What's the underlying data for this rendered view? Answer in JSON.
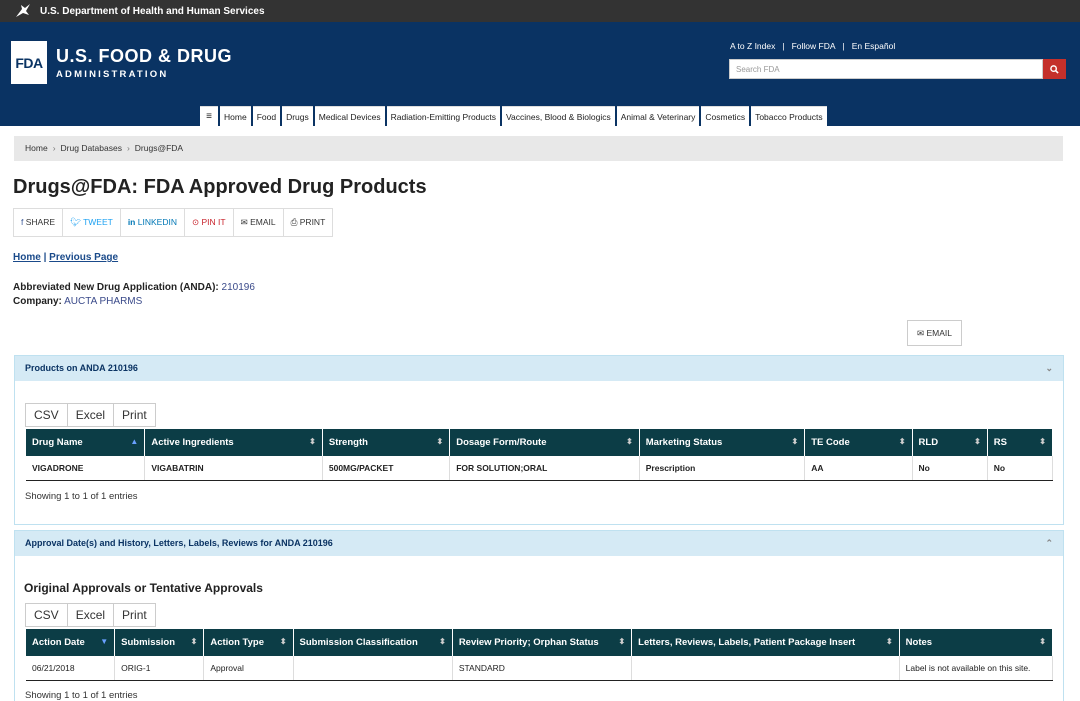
{
  "hhs_bar": "U.S. Department of Health and Human Services",
  "logo": {
    "mark": "FDA",
    "line1": "U.S. FOOD & DRUG",
    "line2": "ADMINISTRATION"
  },
  "util_links": [
    "A to Z Index",
    "Follow FDA",
    "En Español"
  ],
  "search": {
    "placeholder": "Search FDA"
  },
  "nav": [
    "Home",
    "Food",
    "Drugs",
    "Medical Devices",
    "Radiation-Emitting Products",
    "Vaccines, Blood & Biologics",
    "Animal & Veterinary",
    "Cosmetics",
    "Tobacco Products"
  ],
  "breadcrumb": [
    "Home",
    "Drug Databases",
    "Drugs@FDA"
  ],
  "page_title": "Drugs@FDA: FDA Approved Drug Products",
  "share": {
    "facebook": "SHARE",
    "twitter": "TWEET",
    "linkedin": "LINKEDIN",
    "pinterest": "PIN IT",
    "email": "EMAIL",
    "print": "PRINT"
  },
  "links": {
    "home": "Home",
    "sep": " | ",
    "previous": "Previous Page"
  },
  "application": {
    "label": "Abbreviated New Drug Application (ANDA):",
    "number": "210196",
    "company_label": "Company:",
    "company": "AUCTA PHARMS"
  },
  "email_button": "EMAIL",
  "products_panel": {
    "title": "Products on ANDA 210196",
    "export": [
      "CSV",
      "Excel",
      "Print"
    ],
    "columns": [
      "Drug Name",
      "Active Ingredients",
      "Strength",
      "Dosage Form/Route",
      "Marketing Status",
      "TE Code",
      "RLD",
      "RS"
    ],
    "rows": [
      [
        "VIGADRONE",
        "VIGABATRIN",
        "500MG/PACKET",
        "FOR SOLUTION;ORAL",
        "Prescription",
        "AA",
        "No",
        "No"
      ]
    ],
    "info": "Showing 1 to 1 of 1 entries"
  },
  "approvals_panel": {
    "title": "Approval Date(s) and History, Letters, Labels, Reviews for ANDA 210196",
    "subheading": "Original Approvals or Tentative Approvals",
    "export": [
      "CSV",
      "Excel",
      "Print"
    ],
    "columns": [
      "Action Date",
      "Submission",
      "Action Type",
      "Submission Classification",
      "Review Priority; Orphan Status",
      "Letters, Reviews, Labels, Patient Package Insert",
      "Notes"
    ],
    "rows": [
      [
        "06/21/2018",
        "ORIG-1",
        "Approval",
        "",
        "STANDARD",
        "",
        "Label is not available on this site."
      ]
    ],
    "info": "Showing 1 to 1 of 1 entries"
  },
  "colors": {
    "header_bg": "#0a3363",
    "table_header": "#0c3d46",
    "panel_head": "#d5eaf5",
    "search_button": "#c4302b"
  }
}
